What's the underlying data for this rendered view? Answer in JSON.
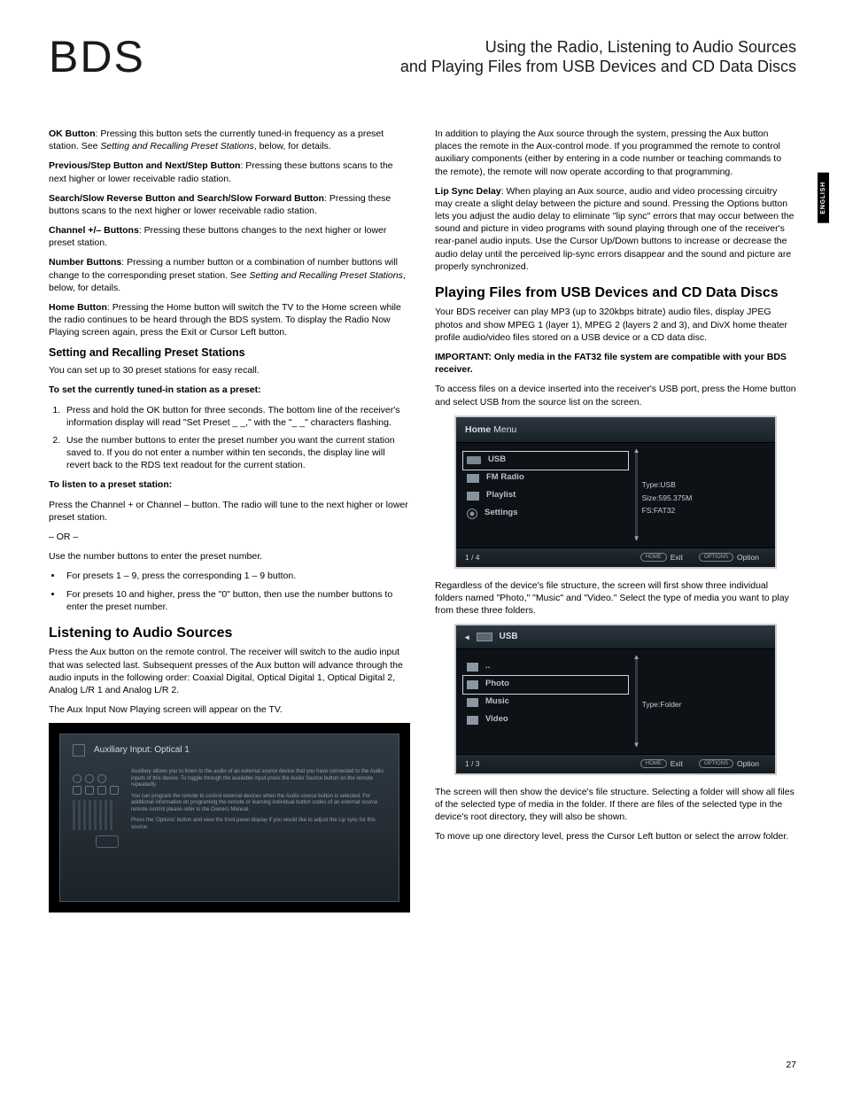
{
  "brand": "BDS",
  "header_line1": "Using the Radio, Listening to Audio Sources",
  "header_line2": "and Playing Files from USB Devices and CD Data Discs",
  "side_tab": "ENGLISH",
  "page_number": "27",
  "left": {
    "p1_bold": "OK Button",
    "p1_rest": ": Pressing this button sets the currently tuned-in frequency as a preset station. See ",
    "p1_em": "Setting and Recalling Preset Stations",
    "p1_tail": ", below, for details.",
    "p2_bold": "Previous/Step Button and Next/Step Button",
    "p2_rest": ": Pressing these buttons scans to the next higher or lower receivable radio station.",
    "p3_bold": "Search/Slow Reverse Button and Search/Slow Forward Button",
    "p3_rest": ": Pressing these buttons scans to the next higher or lower receivable radio station.",
    "p4_bold": "Channel +/– Buttons",
    "p4_rest": ": Pressing these buttons changes to the next higher or lower preset station.",
    "p5_bold": "Number Buttons",
    "p5_rest": ": Pressing a number button or a combination of number buttons will change to the corresponding preset station. See ",
    "p5_em": "Setting and Recalling Preset Stations",
    "p5_tail": ", below, for details.",
    "p6_bold": "Home Button",
    "p6_rest": ": Pressing the Home button will switch the TV to the Home screen while the radio continues to be heard through the BDS system. To display the Radio Now Playing screen again, press the Exit or Cursor Left button.",
    "h_preset": "Setting and Recalling Preset Stations",
    "preset_intro": "You can set up to 30 preset stations for easy recall.",
    "preset_set_bold": "To set the currently tuned-in station as a preset:",
    "ol1": "Press and hold the OK button for three seconds. The bottom line of the receiver's information display will read \"Set Preset _ _,\" with the \"_ _\" characters flashing.",
    "ol2": "Use the number buttons to enter the preset number you want the current station saved to. If you do not enter a number within ten seconds, the display line will revert back to the RDS text readout for the current station.",
    "listen_bold": "To listen to a preset station:",
    "listen_p1": "Press the Channel + or Channel – button. The radio will tune to the next higher or lower preset station.",
    "or": "– OR –",
    "listen_p2": "Use the number buttons to enter the preset number.",
    "ul1": "For presets 1 – 9, press the corresponding 1 – 9 button.",
    "ul2": "For presets 10 and higher, press the \"0\" button, then use the number buttons to enter the preset number.",
    "h_audio": "Listening to Audio Sources",
    "audio_p1": "Press the Aux button on the remote control. The receiver will switch to the audio input that was selected last. Subsequent presses of the Aux button will advance through the audio inputs in the following order: Coaxial Digital, Optical Digital 1, Optical Digital 2, Analog L/R 1 and Analog L/R 2.",
    "audio_p2": "The Aux Input Now Playing screen will appear on the TV.",
    "aux_title": "Auxiliary Input: Optical 1",
    "aux_t1": "Auxiliary allows you to listen to the audio of an external source device that you have connected to the Audio inputs of this device. To toggle through the available input press the Audio Source button on the remote repeatedly.",
    "aux_t2": "You can program the remote to control external devices when the Audio source button is selected. For additional information on programing the remote or learning individual button codes of an external source remote control please refer to the Owners Manual.",
    "aux_t3": "Press the 'Options' button and view the front panel display if you would like to adjust the Lip sync for this source."
  },
  "right": {
    "p1": "In addition to playing the Aux source through the system, pressing the Aux button places the remote in the Aux-control mode. If you programmed the remote to control auxiliary components (either by entering in a code number or teaching commands to the remote), the remote will now operate according to that programming.",
    "p2_bold": "Lip Sync Delay",
    "p2_rest": ": When playing an Aux source, audio and video processing circuitry may create a slight delay between the picture and sound. Pressing the Options button lets you adjust the audio delay to eliminate \"lip sync\" errors that may occur between the sound and picture in video programs with sound playing through one of the receiver's rear-panel audio inputs. Use the Cursor Up/Down buttons to increase or decrease the audio delay until the perceived lip-sync errors disappear and the sound and picture are properly synchronized.",
    "h_play": "Playing Files from USB Devices and CD Data Discs",
    "play_p1": "Your BDS receiver can play MP3 (up to 320kbps bitrate) audio files, display JPEG photos and show MPEG 1 (layer 1), MPEG 2 (layers 2 and 3), and DivX home theater profile audio/video files stored on a USB device or a CD data disc.",
    "important": "IMPORTANT: Only media in the FAT32 file system are compatible with your BDS receiver.",
    "play_p2": "To access files on a device inserted into the receiver's USB port, press the Home button and select USB from the source list on the screen.",
    "menu1": {
      "title_bold": "Home",
      "title_light": " Menu",
      "items": [
        "USB",
        "FM Radio",
        "Playlist",
        "Settings"
      ],
      "info_type": "Type:USB",
      "info_size": "Size:595.375M",
      "info_fs": "FS:FAT32",
      "count": "1 / 4",
      "btn_home": "HOME",
      "btn_home_txt": "Exit",
      "btn_opt": "OPTIONS",
      "btn_opt_txt": "Option"
    },
    "play_p3": "Regardless of the device's file structure, the screen will first show three individual folders named \"Photo,\" \"Music\" and \"Video.\" Select the type of media you want to play from these three folders.",
    "menu2": {
      "crumb": "USB",
      "items": [
        "..",
        "Photo",
        "Music",
        "Video"
      ],
      "info_type": "Type:Folder",
      "count": "1 / 3",
      "btn_home": "HOME",
      "btn_home_txt": "Exit",
      "btn_opt": "OPTIONS",
      "btn_opt_txt": "Option"
    },
    "play_p4": "The screen will then show the device's file structure. Selecting a folder will show all files of the selected type of media in the folder. If there are files of the selected type in the device's root directory, they will also be shown.",
    "play_p5": "To move up one directory level, press the Cursor Left button or select the arrow folder."
  }
}
